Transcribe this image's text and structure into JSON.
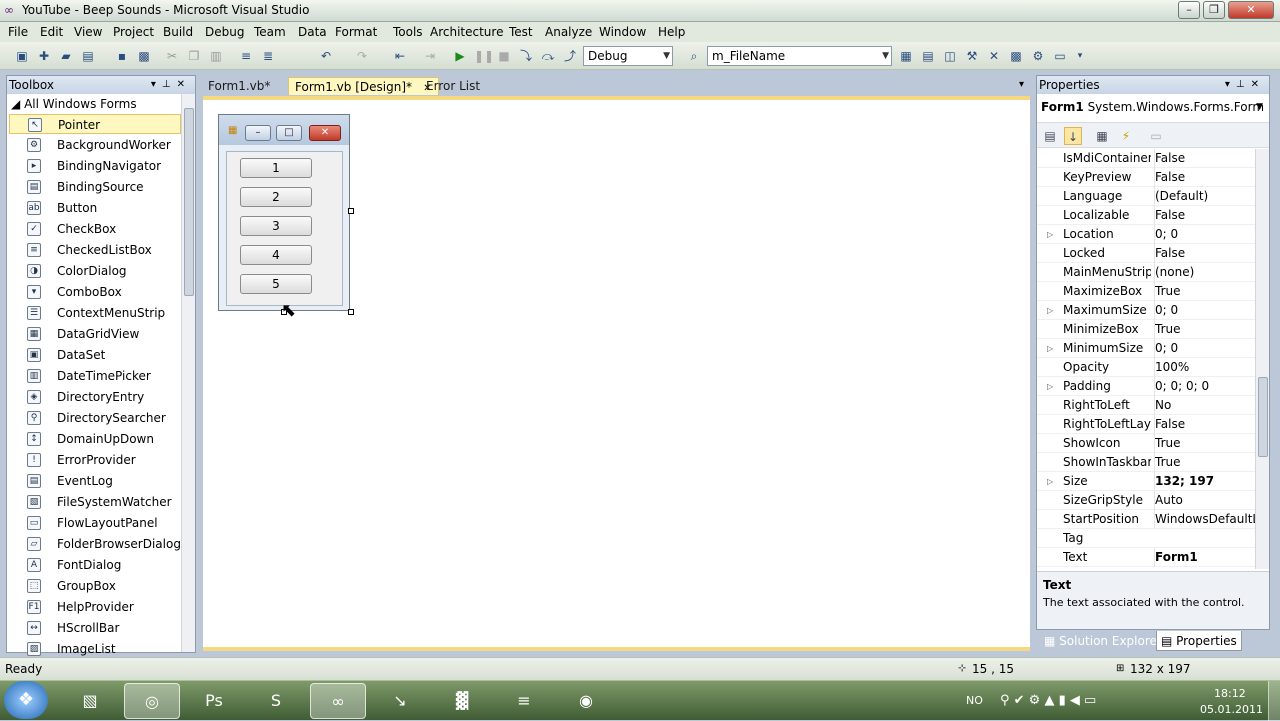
{
  "window": {
    "title": "YouTube - Beep Sounds - Microsoft Visual Studio",
    "minimize": "–",
    "restore": "❐",
    "close": "✕"
  },
  "menu": [
    "File",
    "Edit",
    "View",
    "Project",
    "Build",
    "Debug",
    "Team",
    "Data",
    "Format",
    "Tools",
    "Architecture",
    "Test",
    "Analyze",
    "Window",
    "Help"
  ],
  "toolbar": {
    "config": "Debug",
    "find": "m_FileName"
  },
  "toolbox": {
    "title": "Toolbox",
    "group": "All Windows Forms",
    "items": [
      {
        "label": "Pointer",
        "glyph": "↖"
      },
      {
        "label": "BackgroundWorker",
        "glyph": "⚙"
      },
      {
        "label": "BindingNavigator",
        "glyph": "▸"
      },
      {
        "label": "BindingSource",
        "glyph": "▤"
      },
      {
        "label": "Button",
        "glyph": "ab"
      },
      {
        "label": "CheckBox",
        "glyph": "✓"
      },
      {
        "label": "CheckedListBox",
        "glyph": "≡"
      },
      {
        "label": "ColorDialog",
        "glyph": "◑"
      },
      {
        "label": "ComboBox",
        "glyph": "▾"
      },
      {
        "label": "ContextMenuStrip",
        "glyph": "☰"
      },
      {
        "label": "DataGridView",
        "glyph": "▦"
      },
      {
        "label": "DataSet",
        "glyph": "▣"
      },
      {
        "label": "DateTimePicker",
        "glyph": "▥"
      },
      {
        "label": "DirectoryEntry",
        "glyph": "◈"
      },
      {
        "label": "DirectorySearcher",
        "glyph": "⚲"
      },
      {
        "label": "DomainUpDown",
        "glyph": "↕"
      },
      {
        "label": "ErrorProvider",
        "glyph": "!"
      },
      {
        "label": "EventLog",
        "glyph": "▤"
      },
      {
        "label": "FileSystemWatcher",
        "glyph": "▧"
      },
      {
        "label": "FlowLayoutPanel",
        "glyph": "▭"
      },
      {
        "label": "FolderBrowserDialog",
        "glyph": "▱"
      },
      {
        "label": "FontDialog",
        "glyph": "A"
      },
      {
        "label": "GroupBox",
        "glyph": "⬚"
      },
      {
        "label": "HelpProvider",
        "glyph": "F1"
      },
      {
        "label": "HScrollBar",
        "glyph": "↔"
      },
      {
        "label": "ImageList",
        "glyph": "▨"
      }
    ]
  },
  "doc_tabs": [
    {
      "label": "Form1.vb*",
      "active": false
    },
    {
      "label": "Form1.vb [Design]*",
      "active": true
    },
    {
      "label": "Error List",
      "active": false
    }
  ],
  "designer": {
    "form_buttons": [
      "1",
      "2",
      "3",
      "4",
      "5"
    ]
  },
  "properties": {
    "title": "Properties",
    "object_name": "Form1",
    "object_type": "System.Windows.Forms.Form",
    "rows": [
      {
        "name": "IsMdiContainer",
        "value": "False",
        "expandable": false,
        "bold": false
      },
      {
        "name": "KeyPreview",
        "value": "False",
        "expandable": false,
        "bold": false
      },
      {
        "name": "Language",
        "value": "(Default)",
        "expandable": false,
        "bold": false
      },
      {
        "name": "Localizable",
        "value": "False",
        "expandable": false,
        "bold": false
      },
      {
        "name": "Location",
        "value": "0; 0",
        "expandable": true,
        "bold": false
      },
      {
        "name": "Locked",
        "value": "False",
        "expandable": false,
        "bold": false
      },
      {
        "name": "MainMenuStrip",
        "value": "(none)",
        "expandable": false,
        "bold": false
      },
      {
        "name": "MaximizeBox",
        "value": "True",
        "expandable": false,
        "bold": false
      },
      {
        "name": "MaximumSize",
        "value": "0; 0",
        "expandable": true,
        "bold": false
      },
      {
        "name": "MinimizeBox",
        "value": "True",
        "expandable": false,
        "bold": false
      },
      {
        "name": "MinimumSize",
        "value": "0; 0",
        "expandable": true,
        "bold": false
      },
      {
        "name": "Opacity",
        "value": "100%",
        "expandable": false,
        "bold": false
      },
      {
        "name": "Padding",
        "value": "0; 0; 0; 0",
        "expandable": true,
        "bold": false
      },
      {
        "name": "RightToLeft",
        "value": "No",
        "expandable": false,
        "bold": false
      },
      {
        "name": "RightToLeftLayout",
        "value": "False",
        "expandable": false,
        "bold": false
      },
      {
        "name": "ShowIcon",
        "value": "True",
        "expandable": false,
        "bold": false
      },
      {
        "name": "ShowInTaskbar",
        "value": "True",
        "expandable": false,
        "bold": false
      },
      {
        "name": "Size",
        "value": "132; 197",
        "expandable": true,
        "bold": true
      },
      {
        "name": "SizeGripStyle",
        "value": "Auto",
        "expandable": false,
        "bold": false
      },
      {
        "name": "StartPosition",
        "value": "WindowsDefaultLocation",
        "expandable": false,
        "bold": false
      },
      {
        "name": "Tag",
        "value": "",
        "expandable": false,
        "bold": false
      },
      {
        "name": "Text",
        "value": "Form1",
        "expandable": false,
        "bold": true
      }
    ],
    "desc_title": "Text",
    "desc_text": "The text associated with the control."
  },
  "bottom_tabs": [
    {
      "label": "Solution Explorer",
      "active": false
    },
    {
      "label": "Properties",
      "active": true
    }
  ],
  "status": {
    "text": "Ready",
    "position": "15 , 15",
    "size": "132 x 197"
  },
  "taskbar": {
    "apps": [
      {
        "name": "explorer-task-icon",
        "glyph": "▧",
        "active": false
      },
      {
        "name": "chrome-task-icon",
        "glyph": "◎",
        "active": true
      },
      {
        "name": "photoshop-task-icon",
        "glyph": "Ps",
        "active": false
      },
      {
        "name": "skype-task-icon",
        "glyph": "S",
        "active": false
      },
      {
        "name": "visual-studio-task-icon",
        "glyph": "∞",
        "active": true
      },
      {
        "name": "filezilla-task-icon",
        "glyph": "↘",
        "active": false
      },
      {
        "name": "building-task-icon",
        "glyph": "▓",
        "active": false
      },
      {
        "name": "spotify-task-icon",
        "glyph": "≡",
        "active": false
      },
      {
        "name": "media-task-icon",
        "glyph": "◉",
        "active": false
      }
    ],
    "lang": "NO",
    "time": "18:12",
    "date": "05.01.2011"
  }
}
